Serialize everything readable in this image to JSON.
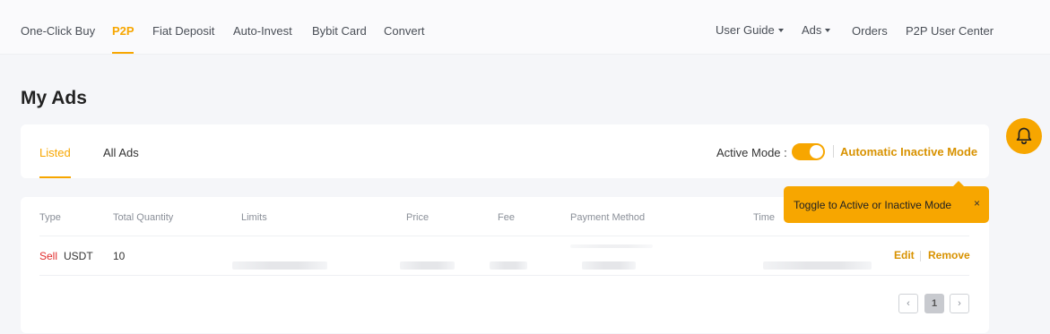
{
  "nav": {
    "left_items": [
      "One-Click Buy",
      "P2P",
      "Fiat Deposit",
      "Auto-Invest",
      "Bybit Card",
      "Convert"
    ],
    "active": "P2P",
    "right_items": {
      "user_guide": "User Guide",
      "ads": "Ads",
      "orders": "Orders",
      "p2p_user_center": "P2P User Center"
    }
  },
  "page": {
    "title": "My Ads"
  },
  "tabs": {
    "listed": "Listed",
    "all_ads": "All Ads",
    "active_mode_label": "Active Mode :",
    "active_mode_on": true,
    "automatic_inactive_mode": "Automatic Inactive Mode"
  },
  "tooltip": {
    "text": "Toggle to Active or Inactive Mode",
    "close": "×"
  },
  "table": {
    "columns": [
      "Type",
      "Total Quantity",
      "Limits",
      "Price",
      "Fee",
      "Payment Method",
      "Time"
    ],
    "rows": [
      {
        "type": "Sell",
        "asset": "USDT",
        "total_quantity": "10"
      }
    ],
    "actions": {
      "edit": "Edit",
      "remove": "Remove"
    }
  },
  "pagination": {
    "prev": "‹",
    "current": "1",
    "next": "›"
  },
  "colors": {
    "accent": "#f7a600",
    "sell": "#e02b2b",
    "action": "#d89200"
  },
  "icons": {
    "notification": "bell-icon"
  }
}
